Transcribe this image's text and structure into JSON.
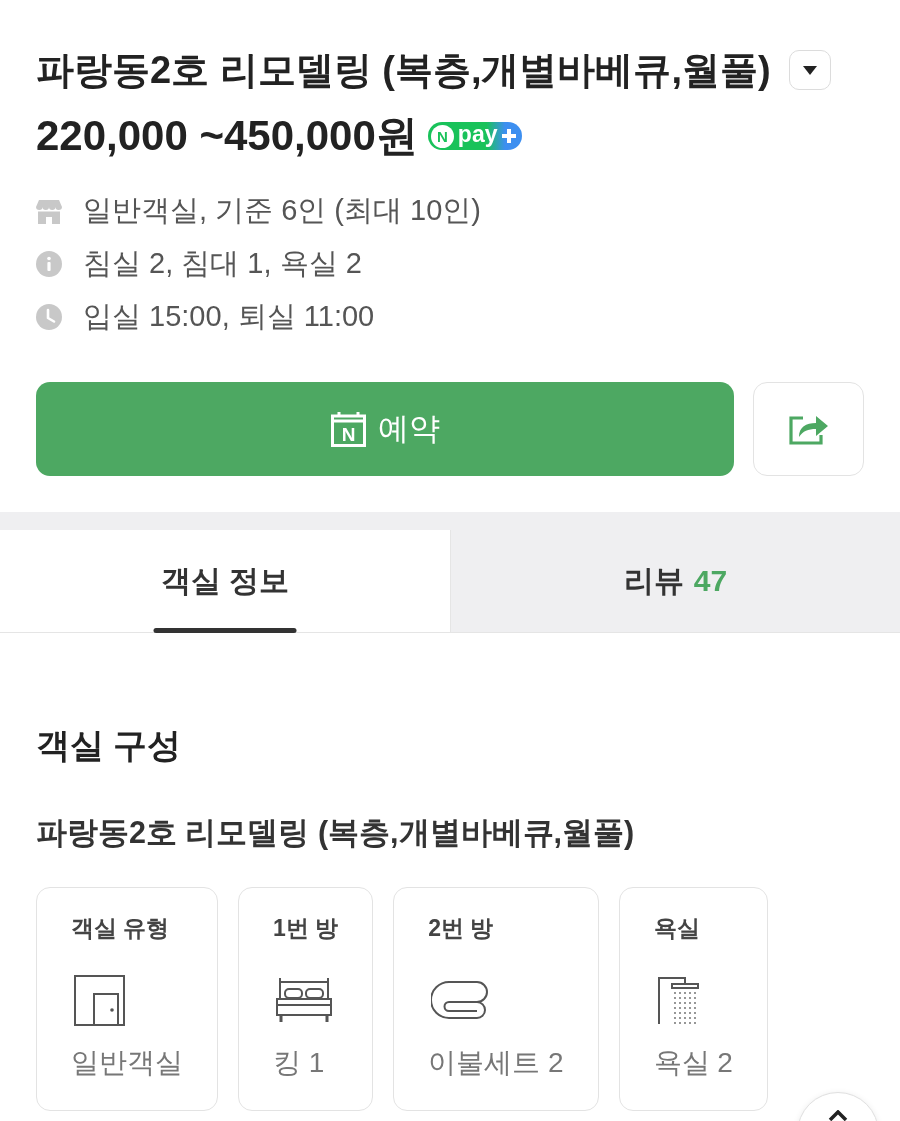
{
  "room": {
    "title": "파랑동2호 리모델링 (복층,개별바베큐,월풀)",
    "price": "220,000 ~450,000원",
    "pay_badge": {
      "mark": "N",
      "text": "pay"
    }
  },
  "details": [
    {
      "kind": "room",
      "text": "일반객실, 기준 6인 (최대 10인)"
    },
    {
      "kind": "info",
      "text": "침실 2, 침대 1, 욕실 2"
    },
    {
      "kind": "time",
      "text": "입실 15:00, 퇴실 11:00"
    }
  ],
  "reserve_button": {
    "icon_mark": "N",
    "label": "예약"
  },
  "tabs": [
    {
      "label": "객실 정보",
      "selected": true
    },
    {
      "label": "리뷰",
      "count": "47",
      "selected": false
    }
  ],
  "composition": {
    "heading": "객실 구성",
    "room_name": "파랑동2호 리모델링 (복층,개별바베큐,월풀)",
    "items": [
      {
        "label": "객실 유형",
        "kind": "door",
        "value": "일반객실"
      },
      {
        "label": "1번 방",
        "kind": "bed",
        "value": "킹 1"
      },
      {
        "label": "2번 방",
        "kind": "blanket",
        "value": "이불세트 2"
      },
      {
        "label": "욕실",
        "kind": "shower",
        "value": "욕실 2"
      }
    ]
  }
}
